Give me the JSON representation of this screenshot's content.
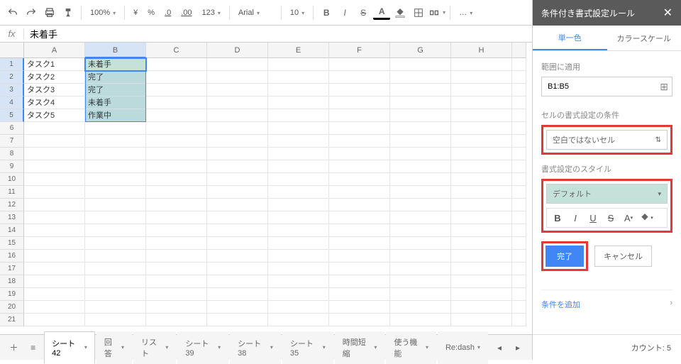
{
  "toolbar": {
    "zoom": "100%",
    "currency": "¥",
    "percent": "%",
    "dec_dec": ".0",
    "dec_inc": ".00",
    "num_fmt": "123",
    "font": "Arial",
    "font_size": "10",
    "bold": "B",
    "italic": "I",
    "strike": "S",
    "underline": "A",
    "text_color": "A",
    "more": "…"
  },
  "formula": {
    "fx": "fx",
    "value": "未着手"
  },
  "columns": [
    "A",
    "B",
    "C",
    "D",
    "E",
    "F",
    "G",
    "H"
  ],
  "rows": [
    "1",
    "2",
    "3",
    "4",
    "5",
    "6",
    "7",
    "8",
    "9",
    "10",
    "11",
    "12",
    "13",
    "14",
    "15",
    "16",
    "17",
    "18",
    "19",
    "20",
    "21"
  ],
  "cells": {
    "A1": "タスク1",
    "A2": "タスク2",
    "A3": "タスク3",
    "A4": "タスク4",
    "A5": "タスク5",
    "B1": "未着手",
    "B2": "完了",
    "B3": "完了",
    "B4": "未着手",
    "B5": "作業中"
  },
  "tabs": {
    "list": [
      "シート42",
      "回答",
      "リスト",
      "シート39",
      "シート38",
      "シート35",
      "時間短縮",
      "使う機能",
      "Re:dash"
    ],
    "active": 0
  },
  "sidebar": {
    "title": "条件付き書式設定ルール",
    "tab_single": "単一色",
    "tab_scale": "カラースケール",
    "range_label": "範囲に適用",
    "range_value": "B1:B5",
    "cond_label": "セルの書式設定の条件",
    "cond_value": "空白ではないセル",
    "style_label": "書式設定のスタイル",
    "style_value": "デフォルト",
    "done": "完了",
    "cancel": "キャンセル",
    "add": "条件を追加",
    "count": "カウント: 5"
  }
}
